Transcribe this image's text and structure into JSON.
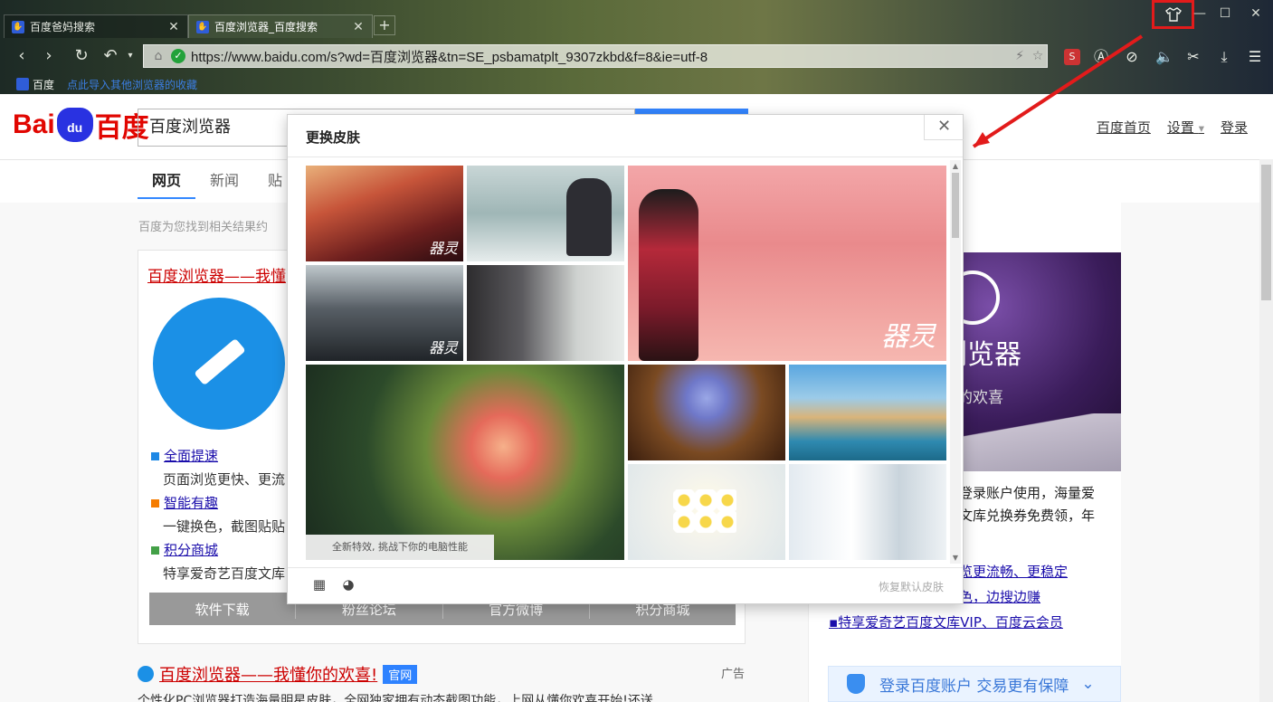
{
  "browser": {
    "tabs": [
      {
        "title": "百度爸妈搜索",
        "active": false
      },
      {
        "title": "百度浏览器_百度搜索",
        "active": true
      }
    ],
    "new_tab_glyph": "+",
    "window_buttons": {
      "minimize": "—",
      "maximize": "☐",
      "close": "✕"
    },
    "skin_icon": "shirt-icon",
    "url": "https://www.baidu.com/s?wd=百度浏览器&tn=SE_psbamatplt_9307zkbd&f=8&ie=utf-8",
    "bookmarks": {
      "baidu_label": "百度",
      "import_label": "点此导入其他浏览器的收藏"
    }
  },
  "baidu": {
    "logo": {
      "left": "Bai",
      "paw": "du",
      "right": "百度"
    },
    "search_query": "百度浏览器",
    "top_links": [
      "百度首页",
      "设置",
      "登录"
    ],
    "nav_tabs": [
      "网页",
      "新闻",
      "贴"
    ],
    "result_count": "百度为您找到相关结果约",
    "result": {
      "title": "百度浏览器——我懂",
      "features": [
        {
          "title": "全面提速",
          "desc": "页面浏览更快、更流",
          "color": "#1e88e5"
        },
        {
          "title": "智能有趣",
          "desc": "一键换色，截图贴贴",
          "color": "#f57c00"
        },
        {
          "title": "积分商城",
          "desc": "特享爱奇艺百度文库",
          "color": "#43a047"
        }
      ],
      "download_bar": [
        "软件下载",
        "粉丝论坛",
        "官方微博",
        "积分商城"
      ]
    },
    "ad": {
      "title": "百度浏览器——我懂你的欢喜!",
      "official_badge": "官网",
      "tag": "广告",
      "desc": "个性化PC浏览器打造海量明星皮肤，全网独家拥有动态截图功能，上网从懂你欢喜开始!还送"
    },
    "right": {
      "promo_name": "浏览器",
      "promo_slogan": "你的欢喜",
      "text_lines": [
        "登录账户使用，海量爱",
        "文库兑换券免费领，年"
      ],
      "links": [
        "览更流畅、更稳定",
        "色，边搜边赚",
        "特享爱奇艺百度文库VIP、百度云会员"
      ],
      "login_bar": "登录百度账户  交易更有保障"
    }
  },
  "skin_panel": {
    "title": "更换皮肤",
    "close_glyph": "✕",
    "caption": "全新特效, 挑战下你的电脑性能",
    "restore_label": "恢复默认皮肤",
    "thumbnails": [
      {
        "name": "skin-thumb-qiling-city",
        "watermark": "器灵"
      },
      {
        "name": "skin-thumb-snow-boy",
        "watermark": ""
      },
      {
        "name": "skin-thumb-qiling-pink-large",
        "watermark": "器灵"
      },
      {
        "name": "skin-thumb-qiling-storm",
        "watermark": "器灵"
      },
      {
        "name": "skin-thumb-couple-balcony",
        "watermark": ""
      },
      {
        "name": "skin-thumb-rose-large",
        "watermark": ""
      },
      {
        "name": "skin-thumb-blue-flowers",
        "watermark": ""
      },
      {
        "name": "skin-thumb-venice",
        "watermark": ""
      },
      {
        "name": "skin-thumb-daisies",
        "watermark": ""
      },
      {
        "name": "skin-thumb-white-window",
        "watermark": ""
      }
    ]
  }
}
